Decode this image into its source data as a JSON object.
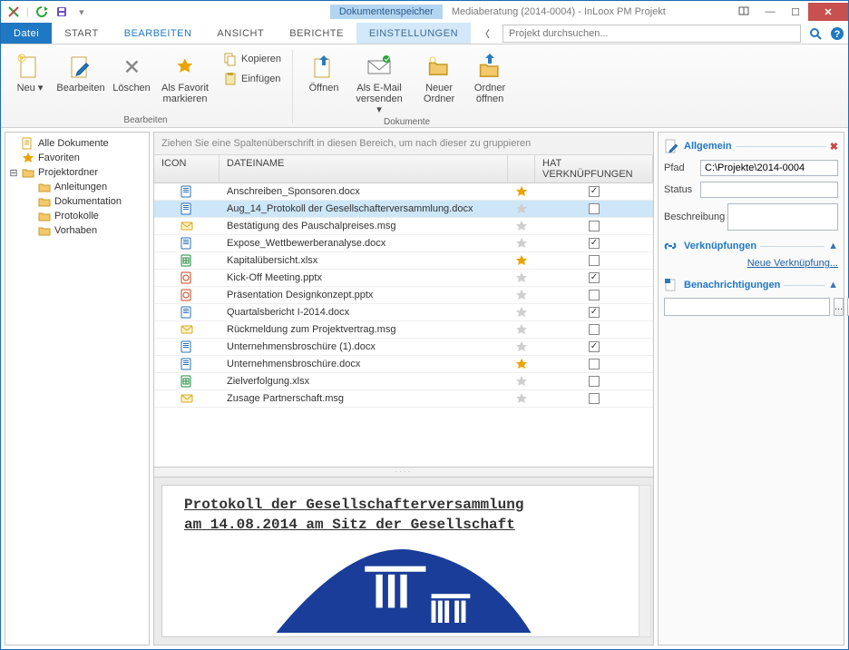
{
  "titlebar": {
    "doc_tab": "Dokumentenspeicher",
    "title": "Mediaberatung (2014-0004) - InLoox PM Projekt"
  },
  "tabs": {
    "file": "Datei",
    "items": [
      "START",
      "BEARBEITEN",
      "ANSICHT",
      "BERICHTE"
    ],
    "active_index": 1,
    "env": "EINSTELLUNGEN",
    "search_placeholder": "Projekt durchsuchen..."
  },
  "ribbon": {
    "neu": "Neu",
    "bearbeiten": "Bearbeiten",
    "loeschen": "Löschen",
    "favorit": "Als Favorit\nmarkieren",
    "kopieren": "Kopieren",
    "einfuegen": "Einfügen",
    "oeffnen": "Öffnen",
    "email": "Als E-Mail\nversenden",
    "neuer_ordner": "Neuer\nOrdner",
    "ordner_oeffnen": "Ordner\nöffnen",
    "group_bearbeiten": "Bearbeiten",
    "group_dokumente": "Dokumente"
  },
  "tree": {
    "root": [
      "Alle Dokumente",
      "Favoriten",
      "Projektordner"
    ],
    "children": [
      "Anleitungen",
      "Dokumentation",
      "Protokolle",
      "Vorhaben"
    ]
  },
  "grid": {
    "group_hint": "Ziehen Sie eine Spaltenüberschrift in diesen Bereich, um nach dieser zu gruppieren",
    "headers": {
      "icon": "ICON",
      "name": "DATEINAME",
      "link": "HAT VERKNÜPFUNGEN"
    },
    "rows": [
      {
        "type": "doc",
        "name": "Anschreiben_Sponsoren.docx",
        "fav": true,
        "link": true,
        "sel": false
      },
      {
        "type": "doc",
        "name": "Aug_14_Protokoll der Gesellschafterversammlung.docx",
        "fav": false,
        "link": false,
        "sel": true
      },
      {
        "type": "msg",
        "name": "Bestätigung des Pauschalpreises.msg",
        "fav": false,
        "link": false,
        "sel": false
      },
      {
        "type": "doc",
        "name": "Expose_Wettbewerberanalyse.docx",
        "fav": false,
        "link": true,
        "sel": false
      },
      {
        "type": "xls",
        "name": "Kapitalübersicht.xlsx",
        "fav": true,
        "link": false,
        "sel": false
      },
      {
        "type": "ppt",
        "name": "Kick-Off Meeting.pptx",
        "fav": false,
        "link": true,
        "sel": false
      },
      {
        "type": "ppt",
        "name": "Präsentation Designkonzept.pptx",
        "fav": false,
        "link": false,
        "sel": false
      },
      {
        "type": "doc",
        "name": "Quartalsbericht I-2014.docx",
        "fav": false,
        "link": true,
        "sel": false
      },
      {
        "type": "msg",
        "name": "Rückmeldung zum Projektvertrag.msg",
        "fav": false,
        "link": false,
        "sel": false
      },
      {
        "type": "doc",
        "name": "Unternehmensbroschüre (1).docx",
        "fav": false,
        "link": true,
        "sel": false
      },
      {
        "type": "doc",
        "name": "Unternehmensbroschüre.docx",
        "fav": true,
        "link": false,
        "sel": false
      },
      {
        "type": "xls",
        "name": "Zielverfolgung.xlsx",
        "fav": false,
        "link": false,
        "sel": false
      },
      {
        "type": "msg",
        "name": "Zusage Partnerschaft.msg",
        "fav": false,
        "link": false,
        "sel": false
      }
    ]
  },
  "preview": {
    "line1": "Protokoll der Gesellschafterversammlung",
    "line2": "am 14.08.2014 am Sitz der Gesellschaft"
  },
  "right": {
    "allgemein": "Allgemein",
    "pfad_label": "Pfad",
    "pfad_value": "C:\\Projekte\\2014-0004",
    "status_label": "Status",
    "beschr_label": "Beschreibung",
    "verkn": "Verknüpfungen",
    "neue_verkn": "Neue Verknüpfung...",
    "benachr": "Benachrichtigungen",
    "dots": "..."
  }
}
